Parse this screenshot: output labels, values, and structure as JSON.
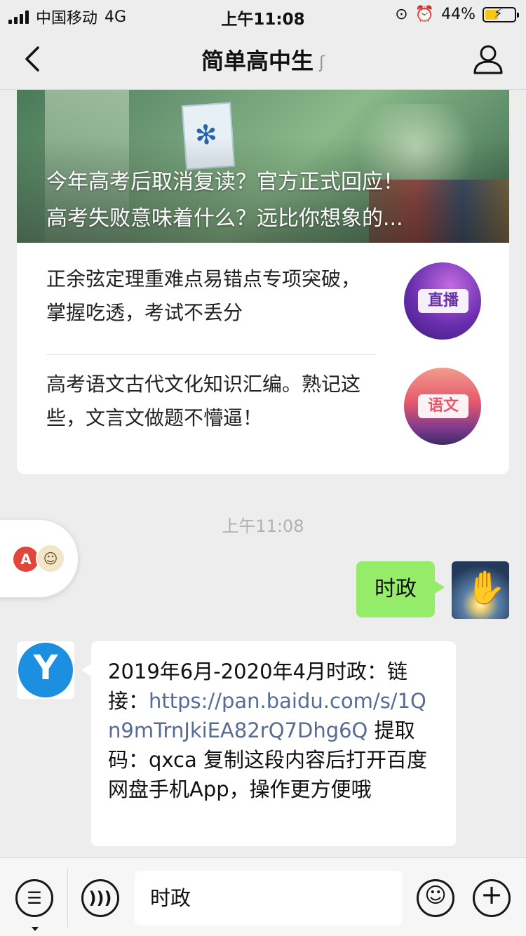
{
  "status_bar": {
    "carrier": "中国移动",
    "network": "4G",
    "time": "上午11:08",
    "battery": "44%",
    "battery_level": 0.44
  },
  "nav": {
    "title": "简单高中生",
    "back_icon": "chevron-left-icon",
    "ear_icon": "ear-icon",
    "profile_icon": "person-icon"
  },
  "article_card": {
    "headlines": [
      "今年高考后取消复读？官方正式回应！",
      "高考失败意味着什么？远比你想象的..."
    ],
    "items": [
      {
        "text": "正余弦定理重难点易错点专项突破，掌握吃透，考试不丢分",
        "thumb_label": "直播"
      },
      {
        "text": "高考语文古代文化知识汇编。熟记这些，文言文做题不懵逼！",
        "thumb_label": "语文"
      }
    ]
  },
  "timestamp": "上午11:08",
  "messages": {
    "outgoing": "时政",
    "incoming": {
      "prefix": "2019年6月-2020年4月时政：链接：",
      "link": "https://pan.baidu.com/s/1Qn9mTrnJkiEA82rQ7Dhg6Q",
      "suffix": " 提取码：qxca 复制这段内容后打开百度网盘手机App，操作更方便哦"
    }
  },
  "input_bar": {
    "value": "时政",
    "icons": [
      "menu-icon",
      "voice-icon",
      "emoji-icon",
      "plus-icon"
    ]
  },
  "colors": {
    "outgoing_bubble": "#95ec69",
    "link": "#576b95",
    "background": "#ededed"
  }
}
